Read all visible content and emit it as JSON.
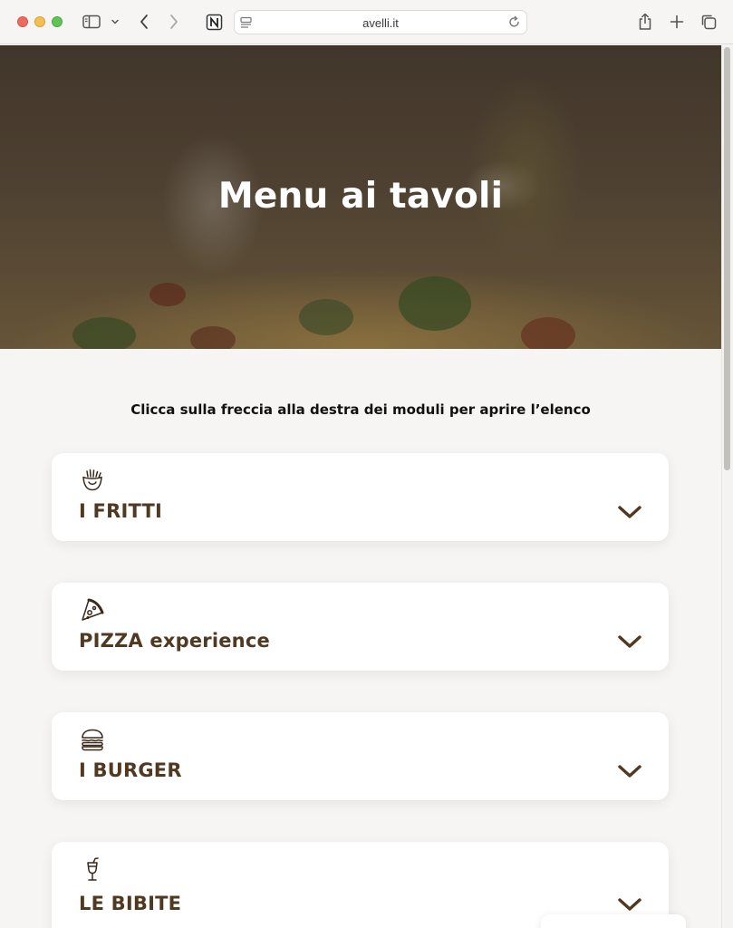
{
  "browser": {
    "url": "avelli.it",
    "icons": [
      "sidebar-icon",
      "chevron-down-icon",
      "back-icon",
      "forward-icon",
      "notion-icon",
      "reader-icon",
      "reload-icon",
      "share-icon",
      "new-tab-icon",
      "tabs-overview-icon"
    ]
  },
  "hero": {
    "title": "Menu ai tavoli"
  },
  "instruction": "Clicca sulla freccia alla destra dei moduli per aprire l’elenco",
  "sections": [
    {
      "label": "I FRITTI",
      "icon": "fries-icon"
    },
    {
      "label": "PIZZA experience",
      "icon": "pizza-slice-icon"
    },
    {
      "label": "I BURGER",
      "icon": "burger-icon"
    },
    {
      "label": "LE BIBITE",
      "icon": "drink-icon"
    }
  ],
  "colors": {
    "accent": "#513921",
    "background": "#f6f5f4",
    "card": "#ffffff"
  }
}
